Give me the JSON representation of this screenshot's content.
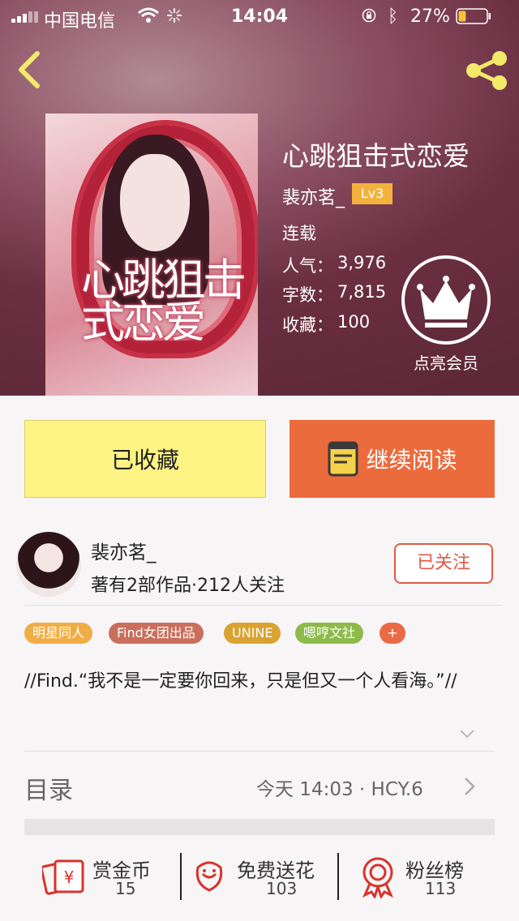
{
  "status_bar": {
    "carrier": "中国电信",
    "time": "14:04",
    "battery_percent": "27%",
    "battery_level": 0.27,
    "icons": [
      "signal-icon",
      "wifi-icon",
      "loading-icon",
      "orientation-lock-icon",
      "bluetooth-icon",
      "battery-icon"
    ]
  },
  "nav": {
    "back_icon": "back-chevron-icon",
    "share_icon": "share-icon"
  },
  "book": {
    "cover_text": "心跳狙击式恋爱",
    "title": "心跳狙击式恋爱",
    "author": "裴亦茗_",
    "level": "Lv3",
    "serial_status": "连载",
    "popularity_label": "人气：",
    "popularity": "3,976",
    "words_label": "字数：",
    "words": "7,815",
    "favorites_label": "收藏：",
    "favorites": "100",
    "vip_label": "点亮会员"
  },
  "actions": {
    "favorited_label": "已收藏",
    "continue_label": "继续阅读"
  },
  "author_row": {
    "name": "裴亦茗_",
    "info": "著有2部作品·212人关注",
    "follow_label": "已关注"
  },
  "tags": [
    "明星同人",
    "Find女团出品",
    "UNINE",
    "嗯哼文社",
    "+"
  ],
  "description": "//Find.“我不是一定要你回来，只是但又一个人看海。”//",
  "toc": {
    "label": "目录",
    "update": "今天 14:03 · HCY.6"
  },
  "stats": [
    {
      "label": "赏金币",
      "value": "15",
      "icon": "coin-envelope-icon"
    },
    {
      "label": "免费送花",
      "value": "103",
      "icon": "flower-icon"
    },
    {
      "label": "粉丝榜",
      "value": "113",
      "icon": "medal-icon"
    }
  ],
  "colors": {
    "accent_orange": "#ec6b3c",
    "button_yellow": "#fdf384",
    "follow_red": "#e05a46",
    "level_badge": "#f4b23d"
  }
}
